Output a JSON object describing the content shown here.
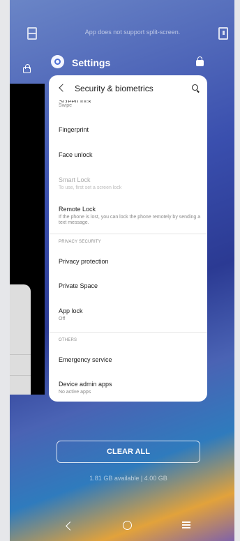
{
  "top": {
    "split_message": "App does not support split-screen."
  },
  "app": {
    "title": "Settings"
  },
  "screen": {
    "title": "Security & biometrics",
    "partial_item": {
      "title": "Screen lock",
      "subtitle": "Swipe"
    },
    "items": [
      {
        "title": "Fingerprint"
      },
      {
        "title": "Face unlock"
      },
      {
        "title": "Smart Lock",
        "subtitle": "To use, first set a screen lock",
        "disabled": true
      },
      {
        "title": "Remote Lock",
        "subtitle": "If the phone is lost, you can lock the phone remotely by sending a text message."
      }
    ],
    "section_privacy": "PRIVACY SECURITY",
    "privacy_items": [
      {
        "title": "Privacy protection"
      },
      {
        "title": "Private Space"
      },
      {
        "title": "App lock",
        "subtitle": "Off"
      }
    ],
    "section_others": "OTHERS",
    "others_items": [
      {
        "title": "Emergency service"
      },
      {
        "title": "Device admin apps",
        "subtitle": "No active apps"
      }
    ]
  },
  "bottom": {
    "clear_all": "CLEAR ALL",
    "memory": "1.81 GB available | 4.00 GB"
  },
  "icons": {
    "split": "split-screen-icon",
    "book": "book-icon",
    "lock": "lock-icon",
    "settings": "settings-gear-icon",
    "back": "back-arrow-icon",
    "search": "search-icon",
    "nav_back": "nav-back-icon",
    "nav_home": "nav-home-icon",
    "nav_menu": "nav-menu-icon"
  }
}
